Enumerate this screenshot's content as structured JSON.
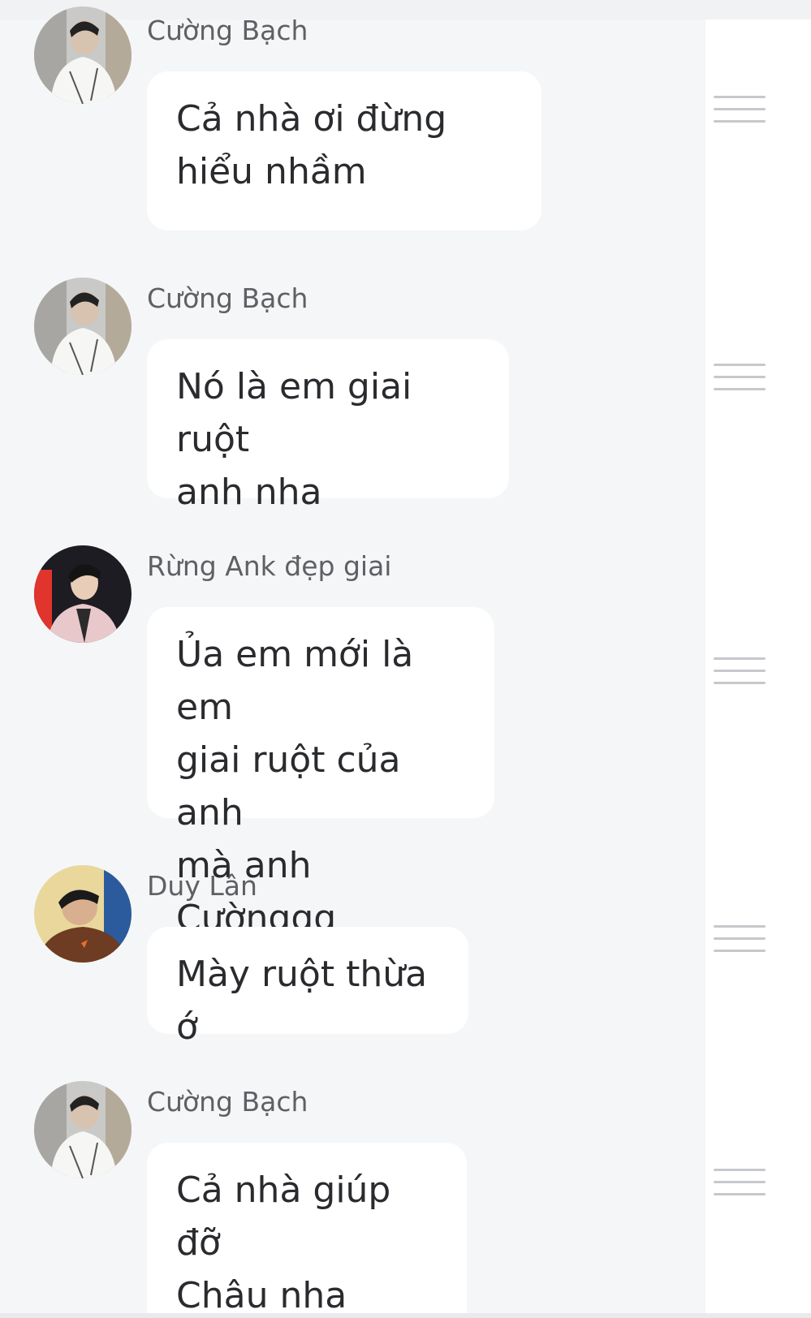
{
  "messages": [
    {
      "sender": "Cường Bạch",
      "avatar_icon": "user-avatar-cuong-bach",
      "text": "Cả nhà ơi đừng\nhiểu nhầm"
    },
    {
      "sender": "Cường Bạch",
      "avatar_icon": "user-avatar-cuong-bach",
      "text": "Nó là em giai ruột\nanh nha"
    },
    {
      "sender": "Rừng Ank đẹp giai",
      "avatar_icon": "user-avatar-rung-ank",
      "text": "Ủa em mới là em\ngiai ruột của anh\nmà anh Cườnggg"
    },
    {
      "sender": "Duy Lân",
      "avatar_icon": "user-avatar-duy-lan",
      "text": "Mày ruột thừa ớ"
    },
    {
      "sender": "Cường Bạch",
      "avatar_icon": "user-avatar-cuong-bach",
      "text": "Cả nhà giúp đỡ\nChâu nha"
    }
  ],
  "colors": {
    "chat_background": "#f5f6f8",
    "bubble": "#ffffff",
    "sender_text": "#5e6063",
    "message_text": "#2a2b2e",
    "drag_handle": "#c6c8cc"
  }
}
